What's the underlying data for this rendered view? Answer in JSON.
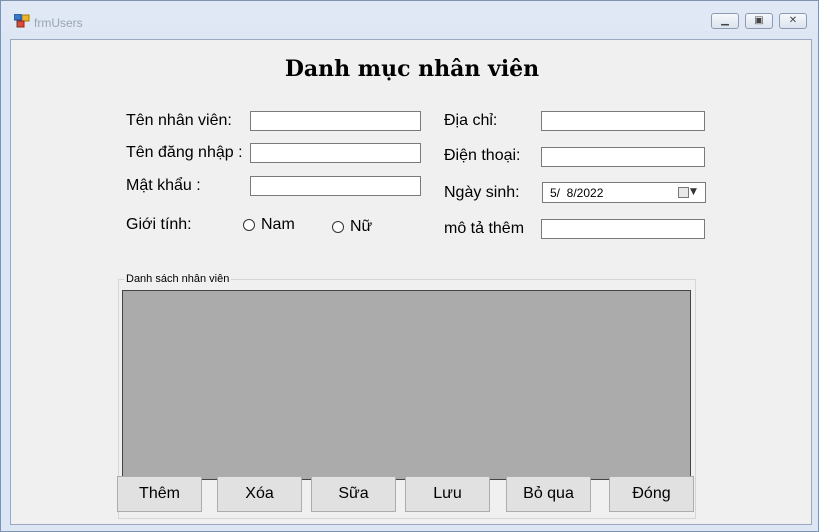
{
  "window": {
    "title": "frmUsers",
    "icons": [
      "app-icon",
      "minimize-icon",
      "maximize-icon",
      "close-icon"
    ]
  },
  "form": {
    "heading": "Danh mục nhân viên",
    "labels": {
      "ten_nhan_vien": "Tên nhân viên:",
      "ten_dang_nhap": "Tên đăng nhập :",
      "mat_khau": "Mật khẩu :",
      "gioi_tinh": "Giới tính:",
      "dia_chi": "Địa chỉ:",
      "dien_thoai": "Điện thoại:",
      "ngay_sinh": "Ngày sinh:",
      "mo_ta_them": "mô tả thêm"
    },
    "inputs": {
      "ten_nhan_vien": "",
      "ten_dang_nhap": "",
      "mat_khau": "",
      "dia_chi": "",
      "dien_thoai": "",
      "mo_ta_them": ""
    },
    "gender": {
      "options": [
        "Nam",
        "Nữ"
      ],
      "selected": null
    },
    "ngay_sinh_value": "5/  8/2022"
  },
  "list": {
    "group_label": "Danh sách nhân viên"
  },
  "buttons": {
    "them": "Thêm",
    "xoa": "Xóa",
    "sua": "Sữa",
    "luu": "Lưu",
    "bo_qua": "Bỏ qua",
    "dong": "Đóng"
  }
}
